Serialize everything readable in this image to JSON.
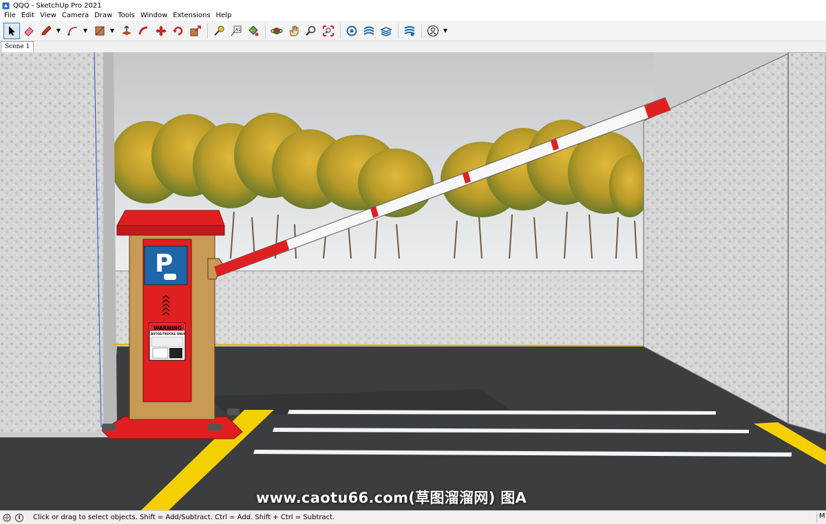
{
  "window": {
    "title": "QQQ - SketchUp Pro 2021"
  },
  "menu": [
    "File",
    "Edit",
    "View",
    "Camera",
    "Draw",
    "Tools",
    "Window",
    "Extensions",
    "Help"
  ],
  "toolbar": {
    "tools": [
      "select-icon",
      "eraser-icon",
      "pencil-icon",
      "arc-icon",
      "rectangle-icon",
      "push-pull-icon",
      "follow-me-icon",
      "move-icon",
      "rotate-icon",
      "scale-icon",
      "tape-measure-icon",
      "text-icon",
      "paint-bucket-icon",
      "orbit-icon",
      "pan-icon",
      "zoom-icon",
      "zoom-extents-icon",
      "3d-warehouse-icon",
      "extension-warehouse-icon",
      "layout-icon",
      "extension-manager-icon",
      "profile-icon"
    ]
  },
  "scene_tabs": [
    "Scene 1"
  ],
  "viewport": {
    "sign_letter": "P",
    "warning_title": "WARNING",
    "warning_sub": "AUTOS/TRUCKS ONLY",
    "watermark": "www.caotu66.com(草图溜溜网) 图A",
    "colors": {
      "barrier_red": "#e02020",
      "curb_yellow": "#f5d000",
      "sign_blue": "#1f66a8",
      "booth_tan": "#c99a55"
    }
  },
  "status": {
    "text": "Click or drag to select objects. Shift = Add/Subtract. Ctrl = Add. Shift + Ctrl = Subtract.",
    "measurements_label": "M"
  }
}
